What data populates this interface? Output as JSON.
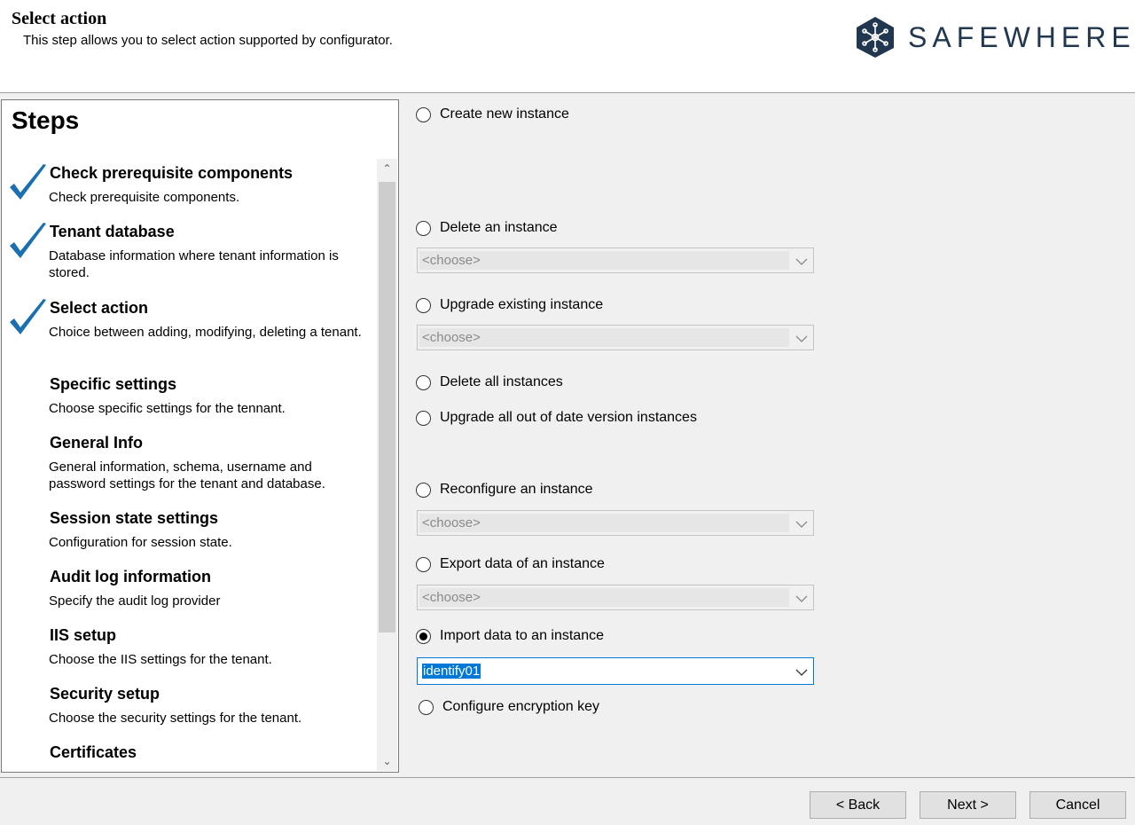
{
  "header": {
    "title": "Select action",
    "subtitle": "This step allows you to select action supported by configurator.",
    "logo_text": "SAFEWHERE",
    "logo_icon": "snowflake-hex-icon",
    "brand_color": "#21374f"
  },
  "steps": {
    "title": "Steps",
    "items": [
      {
        "title": "Check prerequisite components",
        "desc": "Check prerequisite components.",
        "done": true
      },
      {
        "title": "Tenant database",
        "desc": "Database information where tenant information is stored.",
        "done": true
      },
      {
        "title": "Select action",
        "desc": "Choice between adding, modifying, deleting a tenant.",
        "done": true
      },
      {
        "title": "Specific settings",
        "desc": "Choose specific settings for the tennant.",
        "done": false
      },
      {
        "title": "General Info",
        "desc": "General information, schema, username and password settings for the tenant and database.",
        "done": false
      },
      {
        "title": "Session state settings",
        "desc": "Configuration for session state.",
        "done": false
      },
      {
        "title": "Audit log information",
        "desc": "Specify the audit log provider",
        "done": false
      },
      {
        "title": "IIS setup",
        "desc": "Choose the IIS settings for the tenant.",
        "done": false
      },
      {
        "title": "Security setup",
        "desc": "Choose the security settings for the tenant.",
        "done": false
      },
      {
        "title": "Certificates",
        "desc": "",
        "done": false
      }
    ],
    "check_color": "#1a6fb0"
  },
  "actions": {
    "create_new": "Create new instance",
    "delete_one": "Delete an instance",
    "delete_one_value": "<choose>",
    "upgrade_existing": "Upgrade existing instance",
    "upgrade_existing_value": "<choose>",
    "delete_all": "Delete all instances",
    "upgrade_all": "Upgrade all out of date version instances",
    "reconfigure": "Reconfigure an instance",
    "reconfigure_value": "<choose>",
    "export": "Export data of an instance",
    "export_value": "<choose>",
    "import": "Import data to an instance",
    "import_value": "identify01",
    "configure_key": "Configure encryption key",
    "selected": "import"
  },
  "footer": {
    "back": "< Back",
    "next": "Next >",
    "cancel": "Cancel"
  }
}
